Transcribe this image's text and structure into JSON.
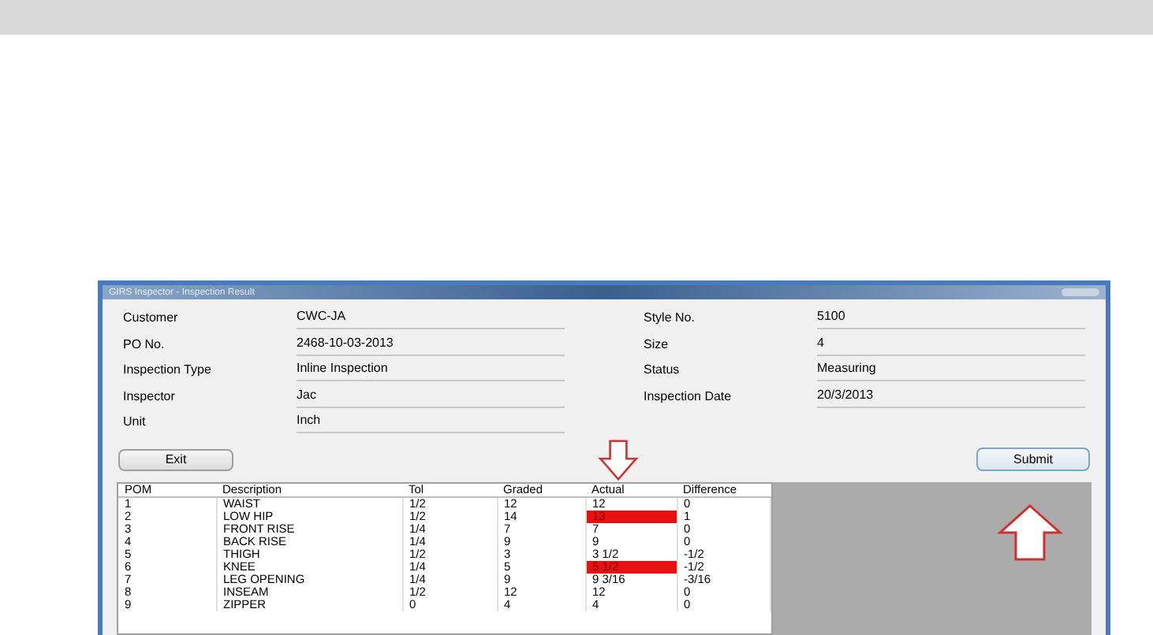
{
  "window": {
    "title": "GIRS Inspector - Inspection Result"
  },
  "fields_left": [
    {
      "label": "Customer",
      "value": "CWC-JA"
    },
    {
      "label": "PO No.",
      "value": "2468-10-03-2013"
    },
    {
      "label": "Inspection Type",
      "value": "Inline Inspection"
    },
    {
      "label": "Inspector",
      "value": "Jac"
    },
    {
      "label": "Unit",
      "value": "Inch"
    }
  ],
  "fields_right": [
    {
      "label": "Style No.",
      "value": "5100"
    },
    {
      "label": "Size",
      "value": "4"
    },
    {
      "label": "Status",
      "value": "Measuring"
    },
    {
      "label": "Inspection Date",
      "value": "20/3/2013"
    }
  ],
  "buttons": {
    "exit": "Exit",
    "submit": "Submit"
  },
  "table": {
    "columns": [
      "POM",
      "Description",
      "Tol",
      "Graded",
      "Actual",
      "Difference"
    ],
    "rows": [
      {
        "cells": [
          "1",
          "WAIST",
          "1/2",
          "12",
          "12",
          "0"
        ],
        "flagged": false
      },
      {
        "cells": [
          "2",
          "LOW HIP",
          "1/2",
          "14",
          "13",
          "1"
        ],
        "flagged": true
      },
      {
        "cells": [
          "3",
          "FRONT RISE",
          "1/4",
          "7",
          "7",
          "0"
        ],
        "flagged": false
      },
      {
        "cells": [
          "4",
          "BACK RISE",
          "1/4",
          "9",
          "9",
          "0"
        ],
        "flagged": false
      },
      {
        "cells": [
          "5",
          "THIGH",
          "1/2",
          "3",
          "3 1/2",
          "-1/2"
        ],
        "flagged": false
      },
      {
        "cells": [
          "6",
          "KNEE",
          "1/4",
          "5",
          "5 1/2",
          "-1/2"
        ],
        "flagged": true
      },
      {
        "cells": [
          "7",
          "LEG OPENING",
          "1/4",
          "9",
          "9 3/16",
          "-3/16"
        ],
        "flagged": false
      },
      {
        "cells": [
          "8",
          "INSEAM",
          "1/2",
          "12",
          "12",
          "0"
        ],
        "flagged": false
      },
      {
        "cells": [
          "9",
          "ZIPPER",
          "0",
          "4",
          "4",
          "0"
        ],
        "flagged": false
      }
    ]
  }
}
